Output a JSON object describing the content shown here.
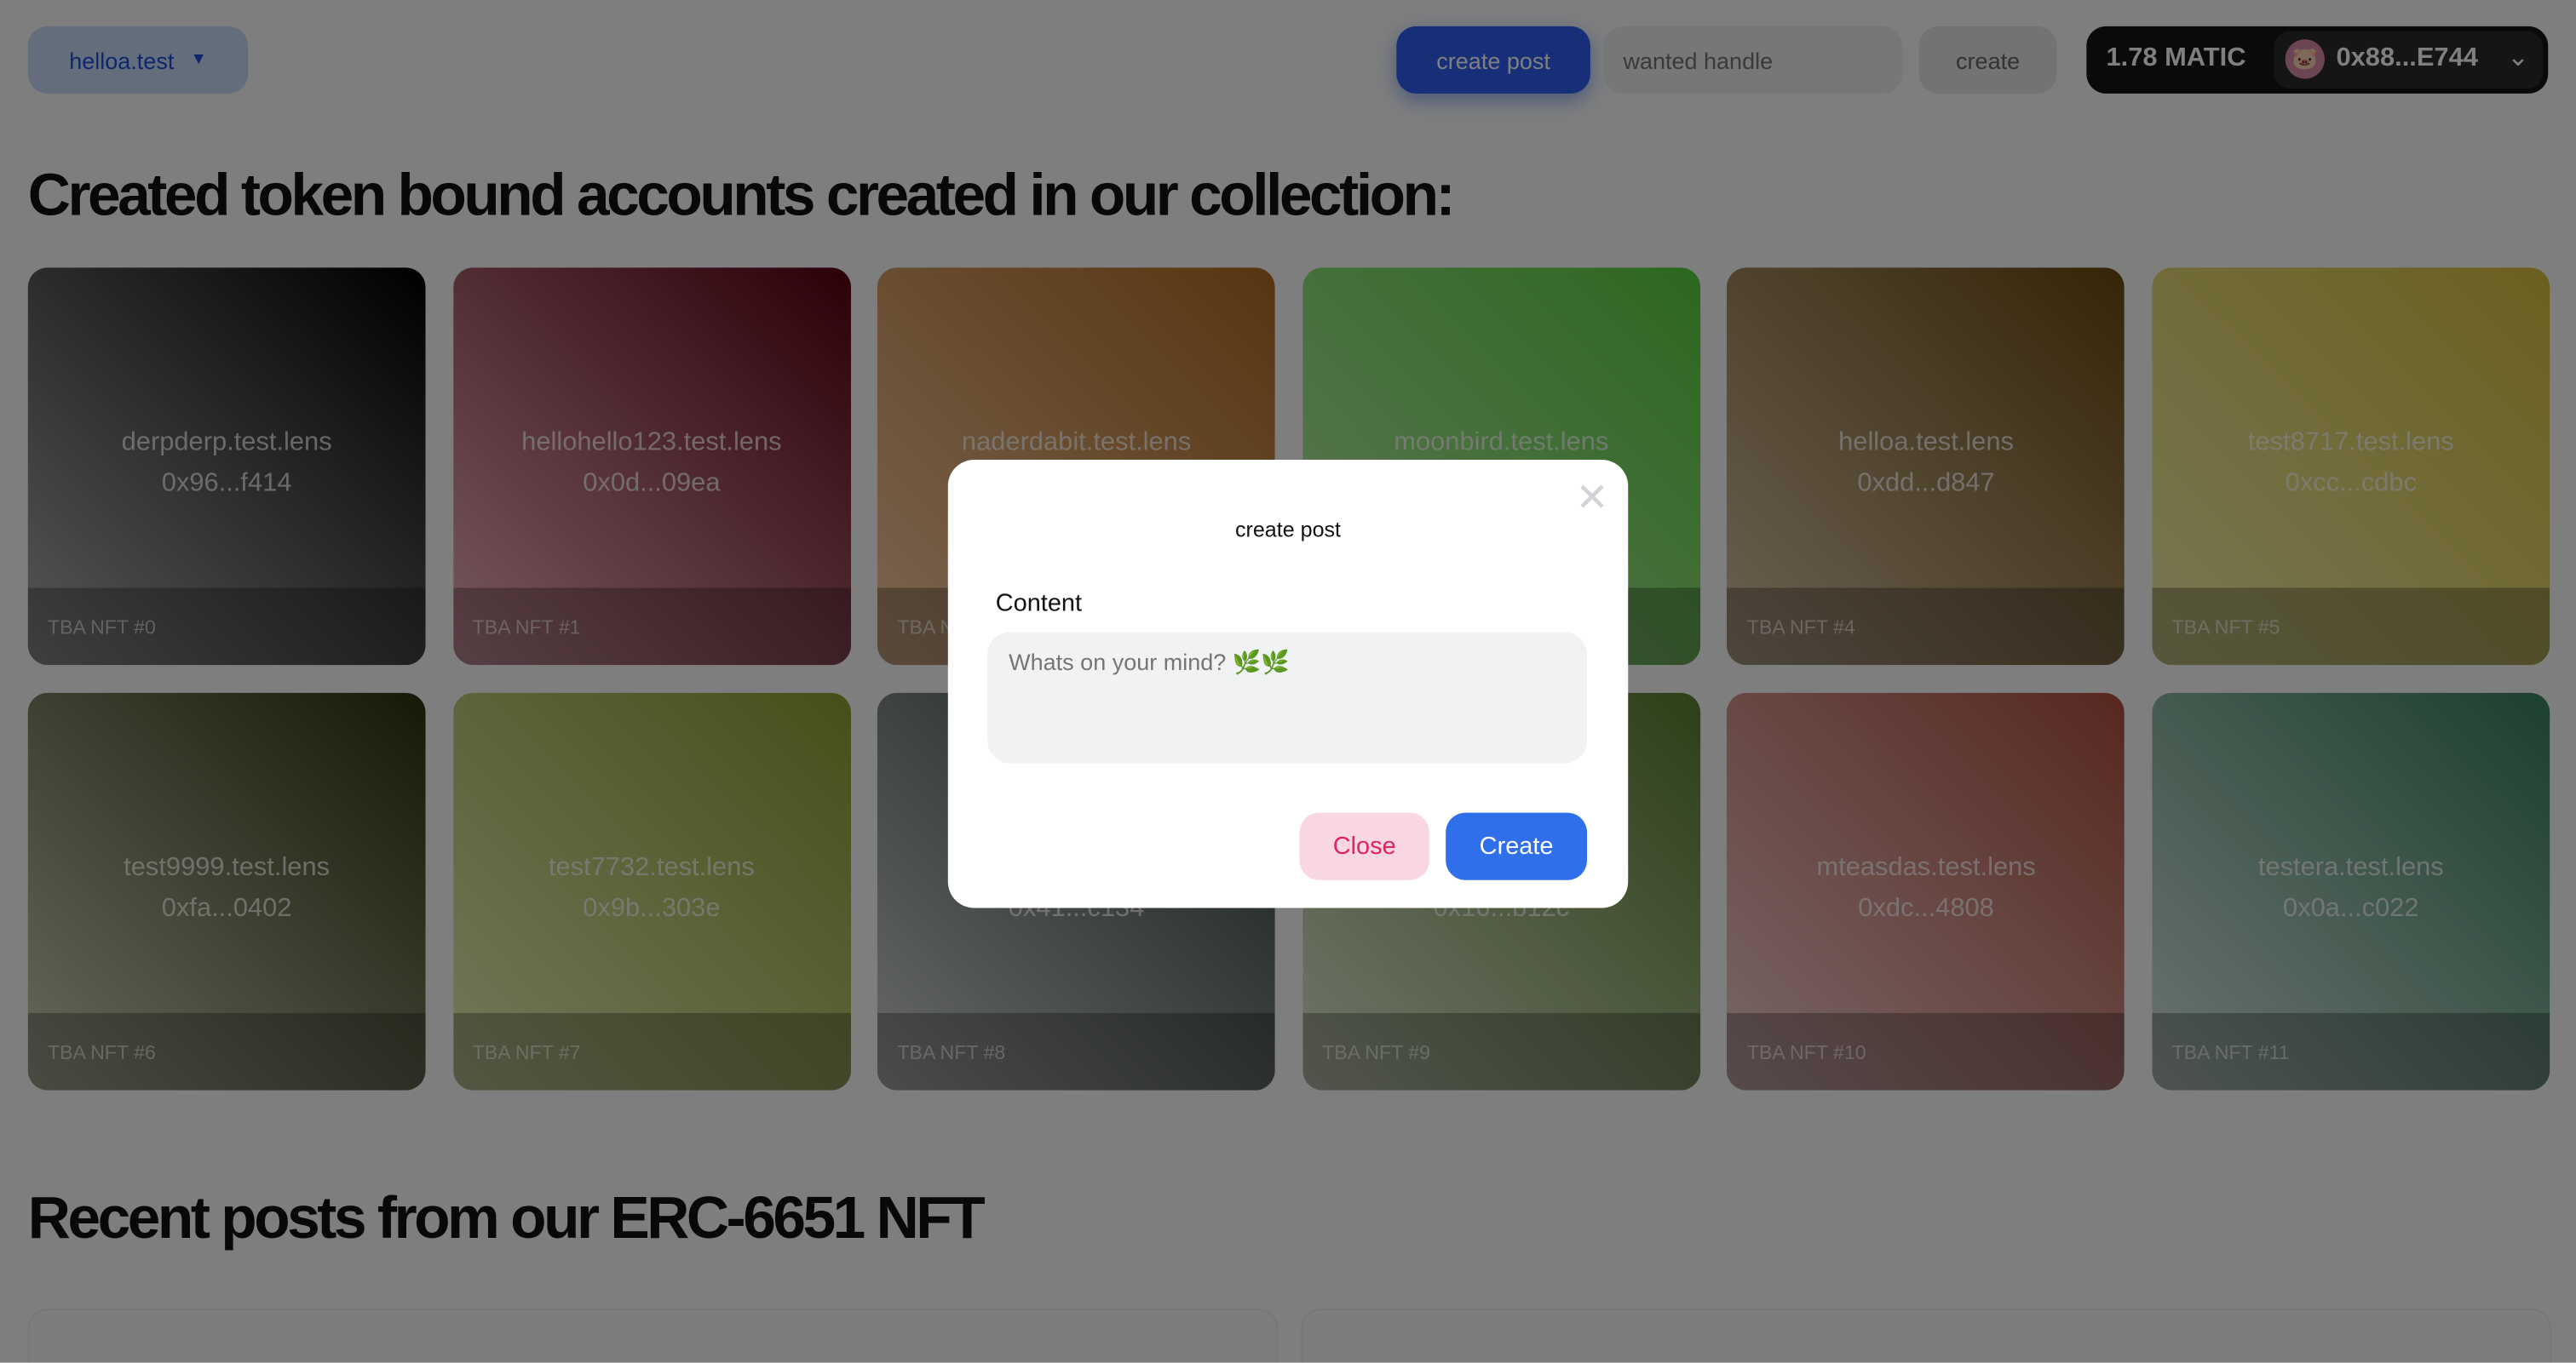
{
  "header": {
    "profile_selector": "helloa.test",
    "create_post_button": "create post",
    "handle_input_placeholder": "wanted handle",
    "create_button": "create",
    "wallet": {
      "balance": "1.78 MATIC",
      "address": "0x88...E744",
      "avatar_icon": "pig-face-icon"
    }
  },
  "sections": {
    "accounts_title": "Created token bound accounts created in our collection:",
    "posts_title": "Recent posts from our ERC-6651 NFT"
  },
  "cards": [
    {
      "name": "derpderp.test.lens",
      "address": "0x96...f414",
      "label": "TBA NFT #0",
      "colors": [
        "#b0b0b0",
        "#000000"
      ]
    },
    {
      "name": "hellohello123.test.lens",
      "address": "0x0d...09ea",
      "label": "TBA NFT #1",
      "colors": [
        "#f0b4c0",
        "#5a0010"
      ]
    },
    {
      "name": "naderdabit.test.lens",
      "address": "",
      "label": "TBA NFT #2",
      "colors": [
        "#f4cca4",
        "#b06a20"
      ]
    },
    {
      "name": "moonbird.test.lens",
      "address": "",
      "label": "",
      "colors": [
        "#bfeeb0",
        "#58d03c"
      ]
    },
    {
      "name": "helloa.test.lens",
      "address": "0xdd...d847",
      "label": "TBA NFT #4",
      "colors": [
        "#d8c4a8",
        "#6a4a10"
      ]
    },
    {
      "name": "test8717.test.lens",
      "address": "0xcc...cdbc",
      "label": "TBA NFT #5",
      "colors": [
        "#f0f0a8",
        "#d8c040"
      ]
    },
    {
      "name": "test9999.test.lens",
      "address": "0xfa...0402",
      "label": "TBA NFT #6",
      "colors": [
        "#d0d0b8",
        "#303010"
      ]
    },
    {
      "name": "test7732.test.lens",
      "address": "0x9b...303e",
      "label": "TBA NFT #7",
      "colors": [
        "#e8f0b8",
        "#8aa030"
      ]
    },
    {
      "name": "",
      "address": "0x41...c134",
      "label": "TBA NFT #8",
      "colors": [
        "#d0d4d0",
        "#2a3a30"
      ]
    },
    {
      "name": "",
      "address": "0x16...b12c",
      "label": "TBA NFT #9",
      "colors": [
        "#e4ecd4",
        "#5a8030"
      ]
    },
    {
      "name": "mteasdas.test.lens",
      "address": "0xdc...4808",
      "label": "TBA NFT #10",
      "colors": [
        "#f0d0d0",
        "#b05040"
      ]
    },
    {
      "name": "testera.test.lens",
      "address": "0x0a...c022",
      "label": "TBA NFT #11",
      "colors": [
        "#d8e8e0",
        "#3a8060"
      ]
    }
  ],
  "modal": {
    "title": "create post",
    "content_label": "Content",
    "content_placeholder": "Whats on your mind? 🌿🌿",
    "close_button": "Close",
    "create_button": "Create"
  },
  "colors": {
    "primary": "#2f6fea",
    "danger_text": "#e0245e",
    "danger_bg": "#f8d7e2"
  }
}
